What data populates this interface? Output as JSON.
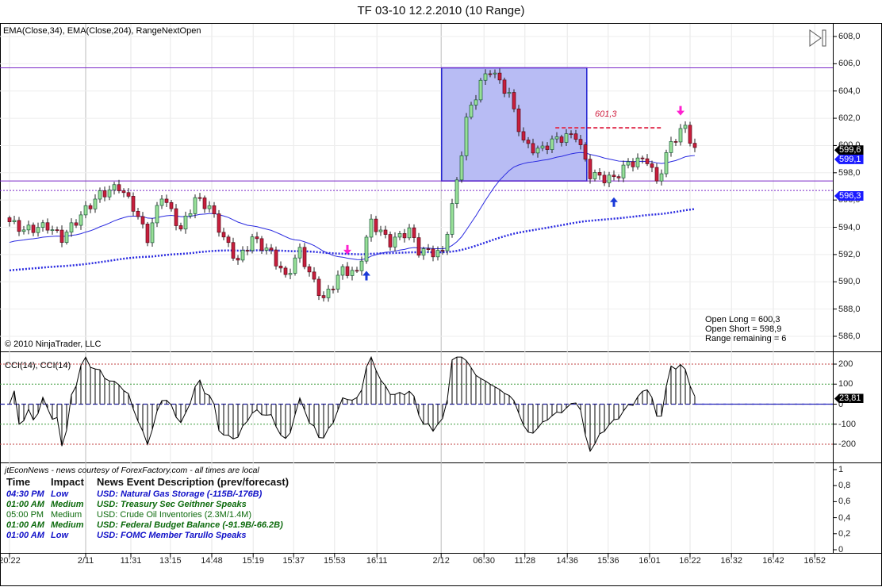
{
  "title": "TF 03-10  12.2.2010 (10 Range)",
  "indicators_label": "EMA(Close,34), EMA(Close,204), RangeNextOpen",
  "copyright": "© 2010 NinjaTrader, LLC",
  "cci_label": "CCI(14), CCI(14)",
  "info": {
    "open_long": "Open Long = 600,3",
    "open_short": "Open Short = 598,9",
    "range_remaining": "Range remaining = 6"
  },
  "level_label": "601,3",
  "price_tags": [
    {
      "text": "599,6",
      "value": 599.6,
      "color": "#000000"
    },
    {
      "text": "599,1",
      "value": 599.1,
      "color": "#1a1aff"
    },
    {
      "text": "596,3",
      "value": 596.3,
      "color": "#1a1aff"
    }
  ],
  "cci_tag": {
    "text": "23,81",
    "value": 23.81
  },
  "colors": {
    "up": "#98e098",
    "down": "#c81e3c",
    "ema": "#2a2ae0",
    "box": "#b8bcf4",
    "hline": "#7a28c8",
    "signal_short": "#ff20d0",
    "signal_long": "#1a3ad8"
  },
  "news": {
    "header_note": "jtEconNews - news courtesy of ForexFactory.com - all times are local",
    "columns": [
      "Time",
      "Impact",
      "News Event Description (prev/forecast)"
    ],
    "rows": [
      {
        "time": "04:30 PM",
        "impact": "Low",
        "desc": "USD: Natural Gas Storage (-115B/-176B)",
        "style": "blue"
      },
      {
        "time": "01:00 AM",
        "impact": "Medium",
        "desc": "USD: Treasury Sec Geithner Speaks",
        "style": "green"
      },
      {
        "time": "05:00 PM",
        "impact": "Medium",
        "desc": "USD: Crude Oil Inventories (2.3M/1.4M)",
        "style": "plain"
      },
      {
        "time": "01:00 AM",
        "impact": "Medium",
        "desc": "USD: Federal Budget Balance (-91.9B/-66.2B)",
        "style": "green"
      },
      {
        "time": "01:00 AM",
        "impact": "Low",
        "desc": "USD: FOMC Member Tarullo Speaks",
        "style": "blue"
      }
    ]
  },
  "chart_data": {
    "type": "candlestick",
    "title": "TF 03-10  12.2.2010 (10 Range)",
    "price_axis": {
      "range": [
        585.4,
        608.8
      ],
      "ticks": [
        "608,0",
        "606,0",
        "604,0",
        "602,0",
        "600,0",
        "598,0",
        "596,0",
        "594,0",
        "592,0",
        "590,0",
        "588,0",
        "586,0"
      ],
      "tick_values": [
        608,
        606,
        604,
        602,
        600,
        598,
        596,
        594,
        592,
        590,
        588,
        586
      ]
    },
    "cci_axis": {
      "ticks": [
        "200",
        "100",
        "0",
        "-100",
        "-200"
      ],
      "tick_values": [
        200,
        100,
        0,
        -100,
        -200
      ]
    },
    "news_axis": {
      "ticks": [
        "1",
        "0,8",
        "0,6",
        "0,4",
        "0,2",
        "0"
      ],
      "tick_values": [
        1,
        0.8,
        0.6,
        0.4,
        0.2,
        0
      ]
    },
    "x_ticks": [
      {
        "label": "20:22",
        "bar": 0
      },
      {
        "label": "2/11",
        "bar": 16
      },
      {
        "label": "11:31",
        "bar": 25.5
      },
      {
        "label": "13:15",
        "bar": 33.8
      },
      {
        "label": "14:48",
        "bar": 42.5
      },
      {
        "label": "15:19",
        "bar": 51.2
      },
      {
        "label": "15:37",
        "bar": 59.7
      },
      {
        "label": "15:53",
        "bar": 68.3
      },
      {
        "label": "16:11",
        "bar": 77.2
      },
      {
        "label": "2/12",
        "bar": 90.7
      },
      {
        "label": "06:30",
        "bar": 99.7
      },
      {
        "label": "11:28",
        "bar": 108.3
      },
      {
        "label": "14:36",
        "bar": 117.2
      },
      {
        "label": "15:36",
        "bar": 125.8
      },
      {
        "label": "16:01",
        "bar": 134.5
      },
      {
        "label": "16:22",
        "bar": 143
      },
      {
        "label": "16:32",
        "bar": 151.7
      },
      {
        "label": "16:42",
        "bar": 160.5
      },
      {
        "label": "16:52",
        "bar": 169.2
      }
    ],
    "bar_count": 145,
    "close_keypoints": [
      [
        0,
        594.4
      ],
      [
        3,
        593.8
      ],
      [
        8,
        594.1
      ],
      [
        11,
        593.2
      ],
      [
        16,
        595.3
      ],
      [
        19,
        596.4
      ],
      [
        23,
        597.0
      ],
      [
        26,
        595.5
      ],
      [
        29,
        593.2
      ],
      [
        32,
        596.4
      ],
      [
        36,
        593.8
      ],
      [
        39,
        596.1
      ],
      [
        42,
        595.5
      ],
      [
        45,
        593.2
      ],
      [
        48,
        591.5
      ],
      [
        51,
        593.2
      ],
      [
        55,
        592.1
      ],
      [
        58,
        590.3
      ],
      [
        61,
        592.3
      ],
      [
        63,
        590.6
      ],
      [
        66,
        588.7
      ],
      [
        70,
        590.9
      ],
      [
        73,
        590.6
      ],
      [
        76,
        594.4
      ],
      [
        80,
        592.9
      ],
      [
        84,
        593.8
      ],
      [
        86,
        592.3
      ],
      [
        91,
        592.1
      ],
      [
        94,
        597.3
      ],
      [
        96,
        601.9
      ],
      [
        99,
        604.6
      ],
      [
        101,
        605.6
      ],
      [
        105,
        603.7
      ],
      [
        108,
        600.2
      ],
      [
        111,
        599.6
      ],
      [
        115,
        600.5
      ],
      [
        119,
        600.8
      ],
      [
        122,
        597.9
      ],
      [
        125,
        597.6
      ],
      [
        127,
        597.6
      ],
      [
        130,
        598.7
      ],
      [
        134,
        599.0
      ],
      [
        136,
        597.3
      ],
      [
        139,
        600.2
      ],
      [
        142,
        601.4
      ],
      [
        144,
        599.6
      ]
    ],
    "ema34_seed": 592.8,
    "ema204_seed": 590.8,
    "horizontal_lines": [
      {
        "price": 605.7,
        "style": "solid"
      },
      {
        "price": 597.4,
        "style": "solid"
      },
      {
        "price": 596.7,
        "style": "dashed"
      }
    ],
    "range_box": {
      "bar_start": 90.8,
      "bar_end": 121.3,
      "price_top": 605.7,
      "price_bottom": 597.4
    },
    "level_line": {
      "price": 601.3,
      "bar_start": 114.7,
      "bar_end": 137.2
    },
    "signals": [
      {
        "type": "short",
        "bar": 71,
        "price": 592.0
      },
      {
        "type": "long",
        "bar": 75,
        "price": 590.8
      },
      {
        "type": "long",
        "bar": 127,
        "price": 596.2
      },
      {
        "type": "short",
        "bar": 141,
        "price": 602.2
      }
    ],
    "cci_levels": [
      200,
      100,
      0,
      -100,
      -200
    ]
  }
}
